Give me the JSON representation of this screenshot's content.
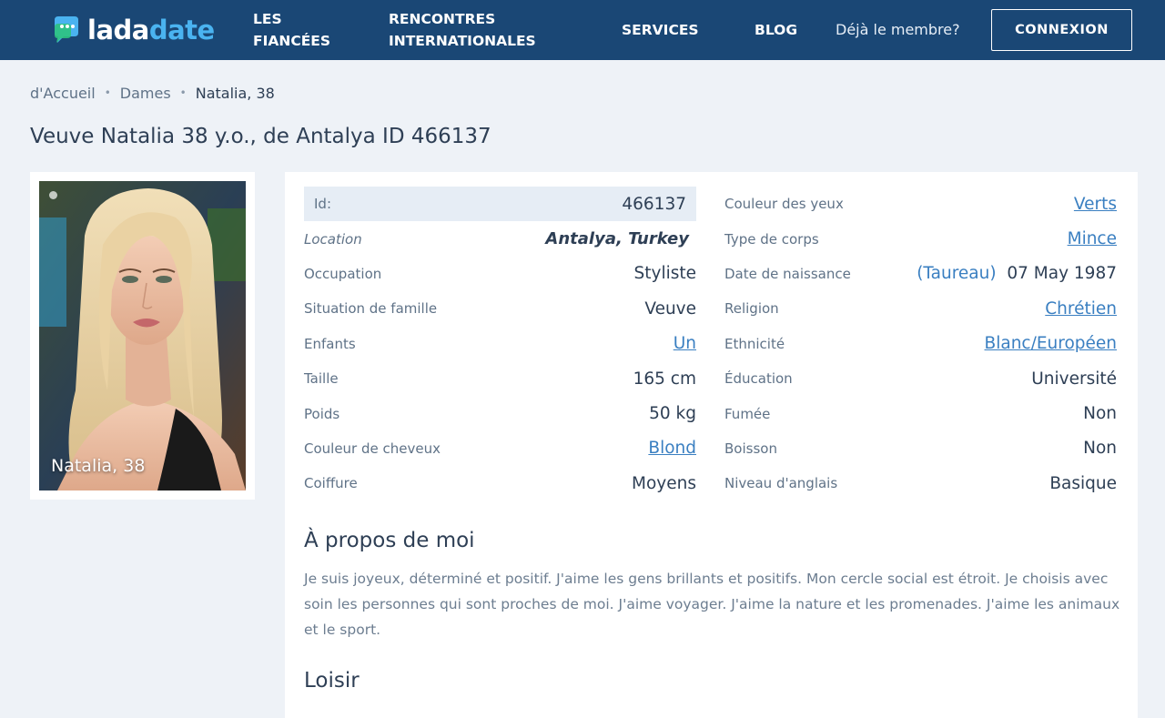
{
  "header": {
    "logo": {
      "part1": "lada",
      "part2": "date"
    },
    "nav": {
      "fiancees_line1": "LES",
      "fiancees_line2": "FIANCÉES",
      "rencontres_line1": "RENCONTRES",
      "rencontres_line2": "INTERNATIONALES",
      "services": "SERVICES",
      "blog": "BLOG"
    },
    "member_text": "Déjà le membre?",
    "login_label": "CONNEXION"
  },
  "breadcrumb": {
    "home": "d'Accueil",
    "section": "Dames",
    "current": "Natalia, 38"
  },
  "page_title": "Veuve Natalia 38 y.o., de Antalya ID 466137",
  "photo": {
    "caption": "Natalia, 38"
  },
  "profile": {
    "left": [
      {
        "label": "Id:",
        "value": "466137"
      },
      {
        "label": "Location",
        "value": "Antalya, Turkey"
      },
      {
        "label": "Occupation",
        "value": "Styliste"
      },
      {
        "label": "Situation de famille",
        "value": "Veuve"
      },
      {
        "label": "Enfants",
        "value": "Un"
      },
      {
        "label": "Taille",
        "value": "165 cm"
      },
      {
        "label": "Poids",
        "value": "50 kg"
      },
      {
        "label": "Couleur de cheveux",
        "value": "Blond"
      },
      {
        "label": "Coiffure",
        "value": "Moyens"
      }
    ],
    "right": [
      {
        "label": "Couleur des yeux",
        "value": "Verts"
      },
      {
        "label": "Type de corps",
        "value": "Mince"
      },
      {
        "label": "Date de naissance",
        "zodiac": "Taureau",
        "open": "(",
        "close": ")",
        "value": "07 May 1987"
      },
      {
        "label": "Religion",
        "value": "Chrétien"
      },
      {
        "label": "Ethnicité",
        "value": "Blanc/Européen"
      },
      {
        "label": "Éducation",
        "value": "Université"
      },
      {
        "label": "Fumée",
        "value": "Non"
      },
      {
        "label": "Boisson",
        "value": "Non"
      },
      {
        "label": "Niveau d'anglais",
        "value": "Basique"
      }
    ]
  },
  "about": {
    "title": "À propos de moi",
    "text": "Je suis joyeux, déterminé et positif. J'aime les gens brillants et positifs. Mon cercle social est étroit. Je choisis avec soin les personnes qui sont proches de moi. J'aime voyager. J'aime la nature et les promenades. J'aime les animaux et le sport."
  },
  "hobby": {
    "title": "Loisir"
  },
  "colors": {
    "header_bg": "#1a4775",
    "accent_blue": "#4ab3f0",
    "link": "#3a7fc1",
    "page_bg": "#eef2f7"
  }
}
